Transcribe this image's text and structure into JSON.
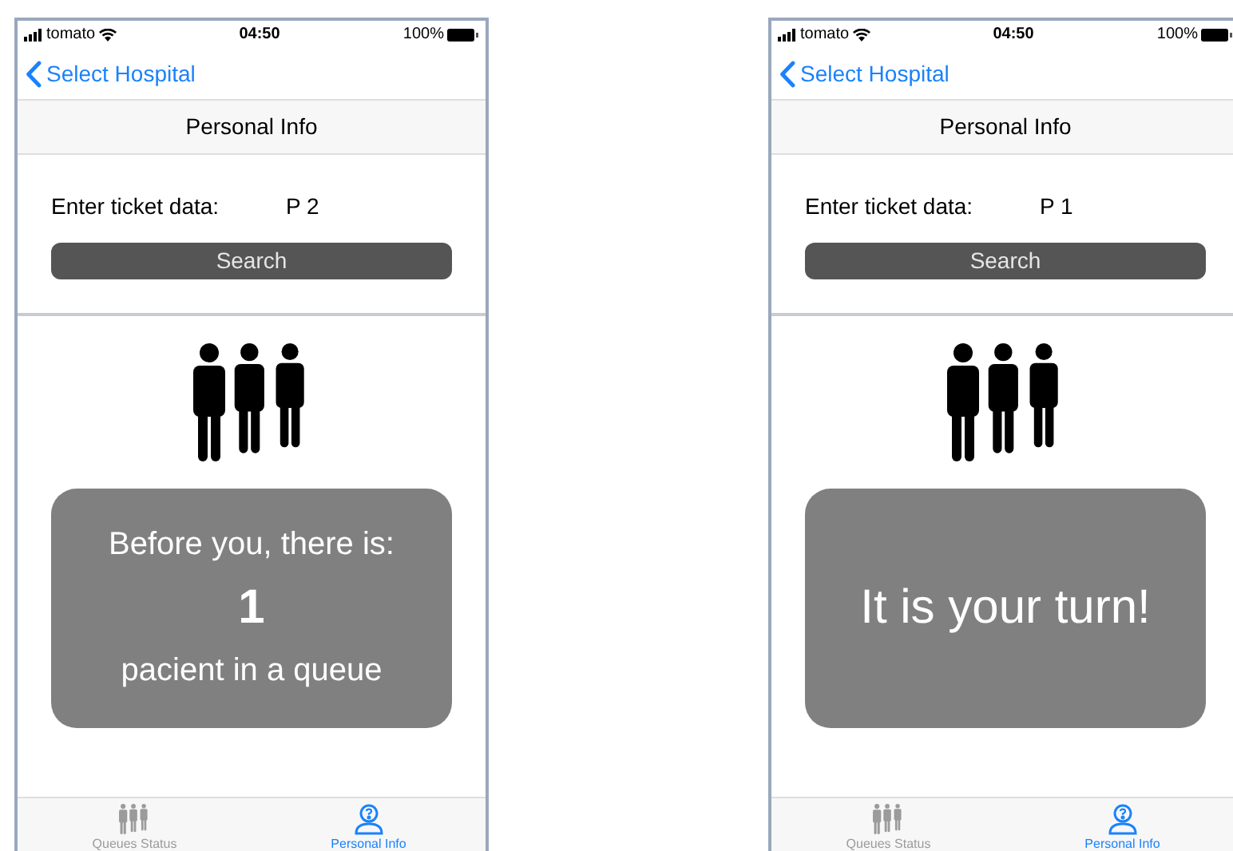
{
  "phones": [
    {
      "status_bar": {
        "carrier": "tomato",
        "time": "04:50",
        "battery": "100%"
      },
      "back_label": "Select Hospital",
      "title": "Personal Info",
      "ticket_label": "Enter ticket data:",
      "ticket_value": "P 2",
      "search_button": "Search",
      "card": {
        "kind": "count",
        "line_1": "Before you, there is:",
        "number": "1",
        "line_2": "pacient in a queue"
      },
      "tabs": [
        {
          "label": "Queues Status",
          "selected": false
        },
        {
          "label": "Personal Info",
          "selected": true
        }
      ]
    },
    {
      "status_bar": {
        "carrier": "tomato",
        "time": "04:50",
        "battery": "100%"
      },
      "back_label": "Select Hospital",
      "title": "Personal Info",
      "ticket_label": "Enter ticket data:",
      "ticket_value": "P 1",
      "search_button": "Search",
      "card": {
        "kind": "turn",
        "message": "It is your turn!"
      },
      "tabs": [
        {
          "label": "Queues Status",
          "selected": false
        },
        {
          "label": "Personal Info",
          "selected": true
        }
      ]
    }
  ]
}
